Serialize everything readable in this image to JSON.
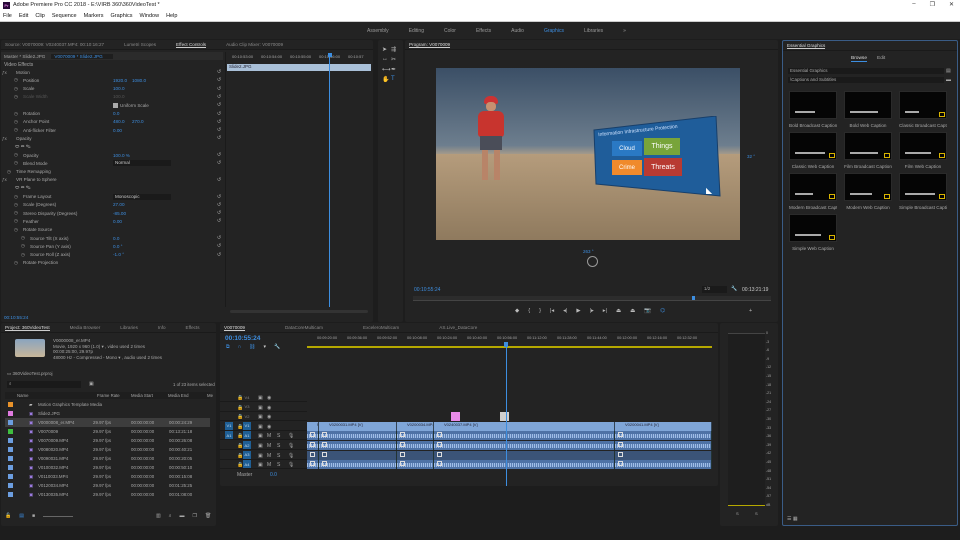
{
  "window": {
    "title": "Adobe Premiere Pro CC 2018 - E:\\VIRB 360\\360VideoTest *",
    "logo": "Pr",
    "controls": [
      "–",
      "❐",
      "✕"
    ]
  },
  "menu": [
    "File",
    "Edit",
    "Clip",
    "Sequence",
    "Markers",
    "Graphics",
    "Window",
    "Help"
  ],
  "workspaces": {
    "items": [
      "Assembly",
      "Editing",
      "Color",
      "Effects",
      "Audio",
      "Graphics",
      "Libraries"
    ],
    "active": "Graphics",
    "overflow": "»"
  },
  "source_panel": {
    "tabs": [
      "Source: V0070009: V0240037.MP4: 00:10:16:27",
      "Lumetri Scopes",
      "Effect Controls",
      "Audio Clip Mixer: V0070009"
    ],
    "master_label": "Master * Slide2.JPG",
    "clip_label": "V0070009 * Slide2.JPG",
    "ruler": [
      "00:10:53:00",
      "00:10:54:00",
      "00:10:55:00",
      "00:10:56:00",
      "00:10:57"
    ],
    "clip_bar": "Slide2.JPG",
    "video_effects": "Video Effects",
    "rows": [
      {
        "indent": 1,
        "label": "Motion",
        "value": "",
        "value2": "",
        "fx": true
      },
      {
        "indent": 2,
        "label": "Position",
        "value": "1920.0",
        "value2": "1080.0"
      },
      {
        "indent": 2,
        "label": "Scale",
        "value": "100.0",
        "value2": ""
      },
      {
        "indent": 2,
        "label": "Scale Width",
        "value": "100.0",
        "value2": "",
        "dim": true
      },
      {
        "indent": 3,
        "label": "",
        "value": "Uniform Scale",
        "value2": "",
        "checkbox": true
      },
      {
        "indent": 2,
        "label": "Rotation",
        "value": "0.0",
        "value2": ""
      },
      {
        "indent": 2,
        "label": "Anchor Point",
        "value": "480.0",
        "value2": "270.0"
      },
      {
        "indent": 2,
        "label": "Anti-flicker Filter",
        "value": "0.00",
        "value2": ""
      },
      {
        "indent": 1,
        "label": "Opacity",
        "value": "",
        "value2": "",
        "fx": true
      },
      {
        "indent": 2,
        "label": "",
        "value": "",
        "value2": "",
        "masks": true
      },
      {
        "indent": 2,
        "label": "Opacity",
        "value": "100.0 %",
        "value2": ""
      },
      {
        "indent": 2,
        "label": "Blend Mode",
        "value": "Normal",
        "value2": "",
        "select": true
      },
      {
        "indent": 1,
        "label": "Time Remapping",
        "value": "",
        "value2": ""
      },
      {
        "indent": 1,
        "label": "VR Plane to Sphere",
        "value": "",
        "value2": "",
        "fx": true
      },
      {
        "indent": 2,
        "label": "",
        "value": "",
        "value2": "",
        "masks": true
      },
      {
        "indent": 2,
        "label": "Frame Layout",
        "value": "Monoscopic",
        "value2": "",
        "select": true
      },
      {
        "indent": 2,
        "label": "Scale (Degrees)",
        "value": "27.00",
        "value2": ""
      },
      {
        "indent": 2,
        "label": "Stereo Disparity (Degrees)",
        "value": "-85.00",
        "value2": ""
      },
      {
        "indent": 2,
        "label": "Feather",
        "value": "0.00",
        "value2": ""
      },
      {
        "indent": 2,
        "label": "Rotate Source",
        "value": "",
        "value2": ""
      },
      {
        "indent": 3,
        "label": "Source Tilt (X axis)",
        "value": "0.0",
        "value2": ""
      },
      {
        "indent": 3,
        "label": "Source Pan (Y axis)",
        "value": "0.0 °",
        "value2": ""
      },
      {
        "indent": 3,
        "label": "Source Roll (Z axis)",
        "value": "-1.0 °",
        "value2": ""
      },
      {
        "indent": 2,
        "label": "Rotate Projection",
        "value": "",
        "value2": ""
      }
    ],
    "timecode": "00:10:55:24"
  },
  "program": {
    "tab": "Program: V0070009",
    "timecode": "00:10:55:24",
    "duration": "00:13:21:19",
    "zoom": "1/2",
    "vr_h": "32 °",
    "vr_v": "263 °",
    "playhead_fraction": 0.78,
    "slide": {
      "title": "Information Infrastructure Protection",
      "tiles": [
        {
          "label": "Cloud",
          "color": "#2a79c4"
        },
        {
          "label": "Things",
          "color": "#78a43a"
        },
        {
          "label": "Crime",
          "color": "#f08a2c"
        },
        {
          "label": "Threats",
          "color": "#b83a32"
        }
      ]
    },
    "controls": [
      "marker",
      "mark-in",
      "mark-out",
      "go-to-in",
      "step-back",
      "play",
      "step-forward",
      "go-to-out",
      "lift",
      "extract",
      "export-frame",
      "vr-video",
      "add"
    ]
  },
  "graphics": {
    "tab": "Essential Graphics",
    "tabs": [
      "Browse",
      "Edit"
    ],
    "active_tab": "Browse",
    "library": "Essential Graphics",
    "folder": "\\Captions and Subtitles",
    "items": [
      "Bold Broadcast Caption",
      "Bold Web Caption",
      "Classic Broadcast Capt...",
      "Classic Web Caption",
      "Film Broadcast Caption",
      "Film Web Caption",
      "Modern Broadcast Capti...",
      "Modern Web Caption",
      "Simple Broadcast Capti...",
      "Simple Web Caption"
    ]
  },
  "project": {
    "tabs": [
      "Project: 360VideoTest",
      "Media Browser",
      "Libraries",
      "Info",
      "Effects",
      "Marke"
    ],
    "preview": {
      "name": "V0000008_er.MP4",
      "line1": "Movie, 1920 x 960 (1.0) ▾ , video used 2 times",
      "line2": "00:00:25:00, 29.97p",
      "line3": "48000 Hz - Compressed - Mono ▾ , audio used 2 times"
    },
    "project_file": "360VideoTest.prproj",
    "selection": "1 of 23 items selected",
    "columns": [
      "Name",
      "Frame Rate",
      "Media Start",
      "Media End",
      "Me"
    ],
    "rows": [
      {
        "name": "Motion Graphics Template Media",
        "color": "#e8922a",
        "rate": "",
        "start": "",
        "end": "",
        "folder": true
      },
      {
        "name": "Slide2.JPG",
        "color": "#e07be0",
        "rate": "",
        "start": "",
        "end": ""
      },
      {
        "name": "V0000008_er.MP4",
        "color": "#6c9ee0",
        "rate": "29.97 fps",
        "start": "00:00:00:00",
        "end": "00:00:24:29",
        "selected": true
      },
      {
        "name": "V0070009",
        "color": "#3fbf3f",
        "rate": "29.97 fps",
        "start": "00:00:00:00",
        "end": "00:13:21:18"
      },
      {
        "name": "V0070009.MP4",
        "color": "#6c9ee0",
        "rate": "29.97 fps",
        "start": "00:00:00:00",
        "end": "00:00:26:08"
      },
      {
        "name": "V0080020.MP4",
        "color": "#6c9ee0",
        "rate": "29.97 fps",
        "start": "00:00:00:00",
        "end": "00:00:40:21"
      },
      {
        "name": "V0090031.MP4",
        "color": "#6c9ee0",
        "rate": "29.97 fps",
        "start": "00:00:00:00",
        "end": "00:00:20:05"
      },
      {
        "name": "V0100032.MP4",
        "color": "#6c9ee0",
        "rate": "29.97 fps",
        "start": "00:00:00:00",
        "end": "00:00:50:10"
      },
      {
        "name": "V0110033.MP4",
        "color": "#6c9ee0",
        "rate": "29.97 fps",
        "start": "00:00:00:00",
        "end": "00:00:15:08"
      },
      {
        "name": "V0120034.MP4",
        "color": "#6c9ee0",
        "rate": "29.97 fps",
        "start": "00:00:00:00",
        "end": "00:01:25:25"
      },
      {
        "name": "V0130035.MP4",
        "color": "#6c9ee0",
        "rate": "29.97 fps",
        "start": "00:00:00:00",
        "end": "00:01:08:00"
      }
    ]
  },
  "timeline": {
    "tabs": [
      "V0070009",
      "DataCoreMulticam",
      "ExceleroMulticam",
      "AS.Live_DataCore"
    ],
    "active_tab": "V0070009",
    "timecode": "00:10:55:24",
    "ruler": [
      "00:09:20:00",
      "00:09:36:00",
      "00:09:52:00",
      "00:10:08:00",
      "00:10:24:00",
      "00:10:40:00",
      "00:10:56:00",
      "00:11:12:00",
      "00:11:28:00",
      "00:11:44:00",
      "00:12:00:00",
      "00:12:16:00",
      "00:12:32:00"
    ],
    "video_tracks": [
      "V4",
      "V3",
      "V2",
      "V1"
    ],
    "audio_tracks": [
      "A1",
      "A2",
      "A3",
      "A4"
    ],
    "master": "Master",
    "master_value": "0.0",
    "v1_clips": [
      {
        "label": "MP4 [V]"
      },
      {
        "label": "V0200031.MP4 [V]"
      },
      {
        "label": "V0200034.MP4 [V]"
      },
      {
        "label": "V0240037.MP4 [V]"
      },
      {
        "label": "V0200041.MP4 [V]"
      }
    ],
    "v2_items": [
      {
        "color": "#e88be8"
      },
      {
        "color": "#cfcfcf"
      }
    ]
  },
  "meters": {
    "scale": [
      "0",
      "-3",
      "-6",
      "-9",
      "-12",
      "-15",
      "-18",
      "-21",
      "-24",
      "-27",
      "-30",
      "-33",
      "-36",
      "-39",
      "-42",
      "-45",
      "-48",
      "-51",
      "-54",
      "-57",
      "dB"
    ],
    "solo": [
      "S",
      "S"
    ]
  }
}
